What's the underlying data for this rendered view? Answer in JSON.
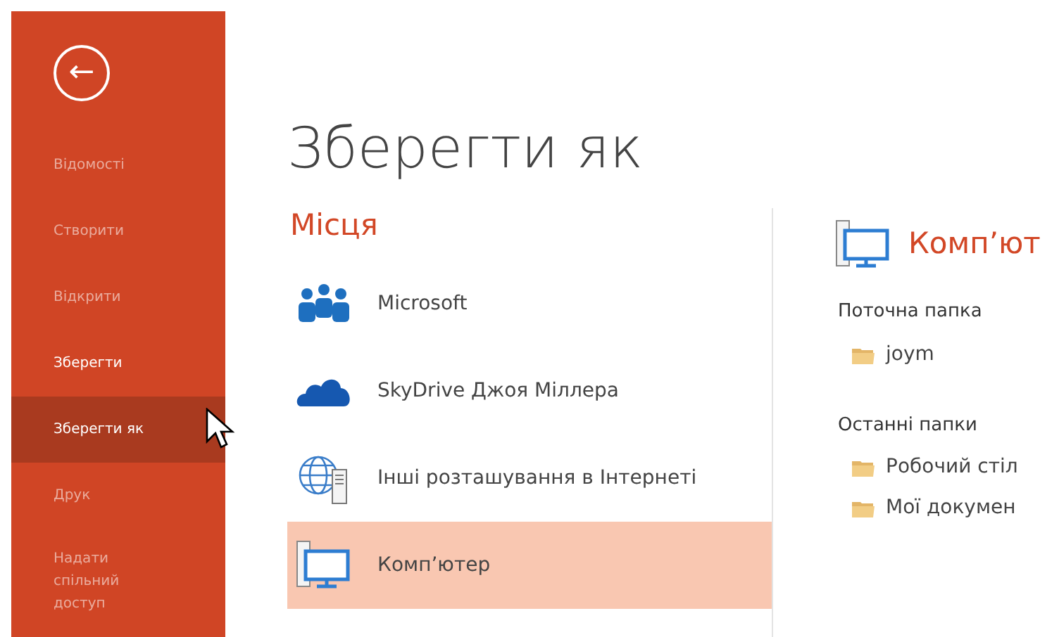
{
  "sidebar": {
    "back_button": "←",
    "items": [
      {
        "label": "Відомості",
        "selected": false,
        "disabled": true
      },
      {
        "label": "Створити",
        "selected": false,
        "disabled": true
      },
      {
        "label": "Відкрити",
        "selected": false,
        "disabled": true
      },
      {
        "label": "Зберегти",
        "selected": false,
        "disabled": false
      },
      {
        "label": "Зберегти як",
        "selected": true,
        "disabled": false
      },
      {
        "label": "Друк",
        "selected": false,
        "disabled": true
      },
      {
        "label": "Надати спільний доступ",
        "selected": false,
        "disabled": true
      }
    ]
  },
  "title": "Зберегти як",
  "places": {
    "heading": "Місця",
    "items": [
      {
        "label": "Microsoft",
        "kind": "people",
        "selected": false
      },
      {
        "label": "SkyDrive Джоя Міллера",
        "kind": "cloud",
        "selected": false
      },
      {
        "label": "Інші розташування в Інтернеті",
        "kind": "globe",
        "selected": false
      },
      {
        "label": "Комп’ютер",
        "kind": "computer",
        "selected": true
      }
    ]
  },
  "computer": {
    "heading": "Комп’ют",
    "sections": [
      {
        "heading": "Поточна папка",
        "folders": [
          "joym"
        ]
      },
      {
        "heading": "Останні папки",
        "folders": [
          "Робочий стіл",
          "Мої докумен"
        ]
      }
    ]
  }
}
